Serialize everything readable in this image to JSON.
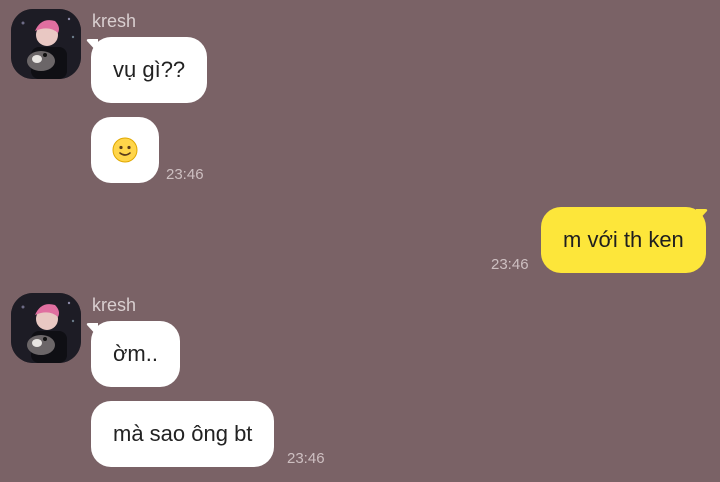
{
  "chat": {
    "groups": [
      {
        "sender": "kresh",
        "messages": [
          "vụ gì??"
        ],
        "emoji_message": "slightly-smiling-face-emoji",
        "time": "23:46"
      },
      {
        "outgoing_message": "m với th ken",
        "time": "23:46"
      },
      {
        "sender": "kresh",
        "messages": [
          "ờm..",
          "mà sao ông bt"
        ],
        "time": "23:46"
      }
    ]
  },
  "colors": {
    "background": "#7a6266",
    "incoming_bubble": "#ffffff",
    "outgoing_bubble": "#fde63a"
  }
}
